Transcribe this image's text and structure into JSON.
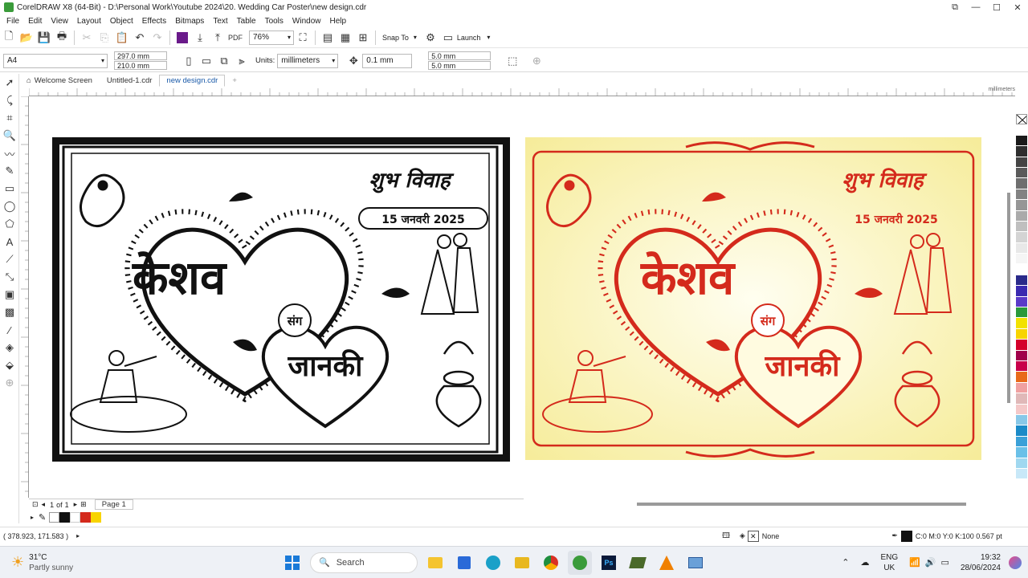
{
  "window": {
    "title": "CorelDRAW X8 (64-Bit) - D:\\Personal Work\\Youtube 2024\\20. Wedding Car Poster\\new design.cdr"
  },
  "menu": [
    "File",
    "Edit",
    "View",
    "Layout",
    "Object",
    "Effects",
    "Bitmaps",
    "Text",
    "Table",
    "Tools",
    "Window",
    "Help"
  ],
  "toolbar": {
    "zoom": "76%",
    "snap_to": "Snap To",
    "launch": "Launch"
  },
  "propertybar": {
    "page_size": "A4",
    "width": "297.0 mm",
    "height": "210.0 mm",
    "units_label": "Units:",
    "units": "millimeters",
    "nudge": "0.1 mm",
    "dup_x": "5.0 mm",
    "dup_y": "5.0 mm"
  },
  "tabs": [
    "Welcome Screen",
    "Untitled-1.cdr",
    "new design.cdr"
  ],
  "ruler": {
    "unit": "millimeters"
  },
  "poster": {
    "title": "शुभ विवाह",
    "date": "15 जनवरी 2025",
    "groom": "केशव",
    "with": "संग",
    "bride": "जानकी"
  },
  "pagenav": {
    "current": "1",
    "of": "of",
    "total": "1",
    "page": "Page 1"
  },
  "status": {
    "coords": "( 378.923, 171.583 )",
    "fill": "None",
    "outline": "C:0 M:0 Y:0 K:100  0.567 pt"
  },
  "taskbar": {
    "temp": "31°C",
    "weather": "Partly sunny",
    "search": "Search",
    "lang1": "ENG",
    "lang2": "UK",
    "time": "19:32",
    "date": "28/06/2024"
  },
  "colors": {
    "accent_red": "#d42a1c",
    "poster_bg": "#f9f3b0",
    "black": "#111111"
  },
  "palette": [
    "#ffffff",
    "#1a1a1a",
    "#2e2e2e",
    "#444444",
    "#5a5a5a",
    "#6e6e6e",
    "#828282",
    "#969696",
    "#aaaaaa",
    "#bfbfbf",
    "#d4d4d4",
    "#e8e8e8",
    "#f5f5f5",
    "#ffffff",
    "#2a2a8a",
    "#3a2ab0",
    "#5a3ac8",
    "#2a9a3a",
    "#f2e200",
    "#f8d400",
    "#d4002a",
    "#a0004a",
    "#c8004a",
    "#e86a1a",
    "#f0a0a0",
    "#e0b8b8",
    "#f4c8c8",
    "#88c8e8",
    "#1a8ac8",
    "#3aa0d8",
    "#6ac0e8",
    "#a0d8f0",
    "#c8e8f8"
  ]
}
